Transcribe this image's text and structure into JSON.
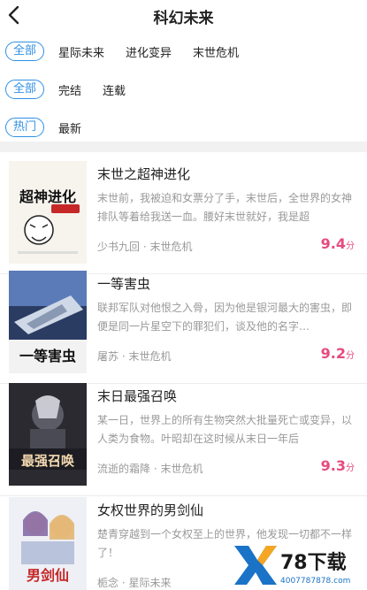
{
  "header": {
    "title": "科幻未来"
  },
  "filters": {
    "category": {
      "selected": "全部",
      "options": [
        "星际未来",
        "进化变异",
        "末世危机"
      ]
    },
    "status": {
      "selected": "全部",
      "options": [
        "完结",
        "连载"
      ]
    },
    "sort": {
      "selected": "热门",
      "options": [
        "最新"
      ]
    }
  },
  "books": [
    {
      "title": "末世之超神进化",
      "description": "末世前，我被迫和女票分了手，末世后，全世界的女神排队等着给我送一血。腰好末世就好，我是超",
      "author": "少书九回",
      "category": "末世危机",
      "score": "9.4",
      "score_unit": "分",
      "cover_text": "超神进化"
    },
    {
      "title": "一等害虫",
      "description": "联邦军队对他恨之入骨，因为他是银河最大的害虫，即便是同一片星空下的罪犯们，谈及他的名字…",
      "author": "屠苏",
      "category": "末世危机",
      "score": "9.2",
      "score_unit": "分",
      "cover_text": "一等害虫"
    },
    {
      "title": "末日最强召唤",
      "description": "某一日，世界上的所有生物突然大批量死亡或变异，以人类为食物。叶昭却在这时候从末日一年后",
      "author": "流逝的霜降",
      "category": "末世危机",
      "score": "9.3",
      "score_unit": "分",
      "cover_text": "最强召唤"
    },
    {
      "title": "女权世界的男剑仙",
      "description": "楚青穿越到一个女权至上的世界，他发现一切都不一样了！",
      "author": "栀念",
      "category": "星际未来",
      "score": "",
      "score_unit": "",
      "cover_text": "男剑仙"
    }
  ],
  "meta_separator": "·",
  "watermark": {
    "text": "78下载",
    "sub": "4007787878.com"
  },
  "colors": {
    "accent": "#2f90e6",
    "score": "#e64a7e",
    "muted": "#999999",
    "gap": "#f1f1f1"
  }
}
